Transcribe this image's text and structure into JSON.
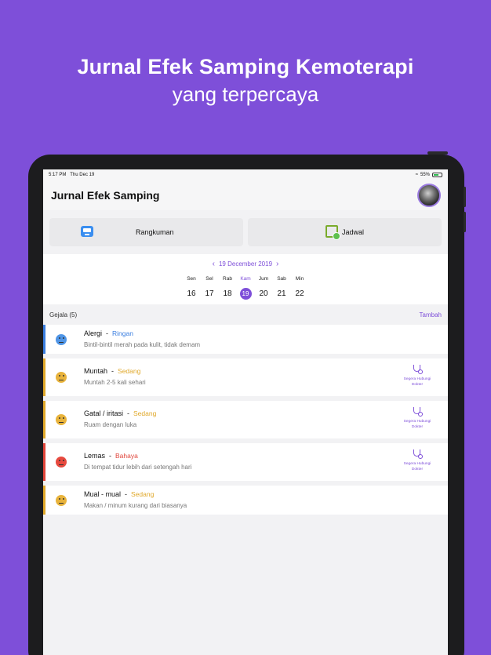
{
  "marketing": {
    "headline": "Jurnal Efek Samping Kemoterapi",
    "subheadline": "yang terpercaya"
  },
  "status_bar": {
    "time": "5:17 PM",
    "date": "Thu Dec 19",
    "battery": "55%"
  },
  "nav": {
    "title": "Jurnal Efek Samping"
  },
  "cards": {
    "summary_label": "Rangkuman",
    "schedule_label": "Jadwal"
  },
  "calendar": {
    "month_label": "19 December 2019",
    "days": [
      {
        "name": "Sen",
        "date": "16"
      },
      {
        "name": "Sel",
        "date": "17"
      },
      {
        "name": "Rab",
        "date": "18"
      },
      {
        "name": "Kam",
        "date": "19"
      },
      {
        "name": "Jum",
        "date": "20"
      },
      {
        "name": "Sab",
        "date": "21"
      },
      {
        "name": "Min",
        "date": "22"
      }
    ],
    "selected_index": 3
  },
  "section": {
    "title": "Gejala (5)",
    "add_label": "Tambah"
  },
  "severity_colors": {
    "Ringan": "#3a7ee0",
    "Sedang": "#e0a82a",
    "Bahaya": "#e0443a"
  },
  "symptoms": [
    {
      "name": "Alergi",
      "sep": "-",
      "severity": "Ringan",
      "desc": "Bintil-bintil merah pada kulit, tidak demam",
      "contact": ""
    },
    {
      "name": "Muntah",
      "sep": "-",
      "severity": "Sedang",
      "desc": "Muntah 2-5 kali sehari",
      "contact": "Segera Hubungi Dokter"
    },
    {
      "name": "Gatal / iritasi",
      "sep": "-",
      "severity": "Sedang",
      "desc": "Ruam dengan luka",
      "contact": "Segera Hubungi Dokter"
    },
    {
      "name": "Lemas",
      "sep": "-",
      "severity": "Bahaya",
      "desc": "Di tempat tidur lebih dari setengah hari",
      "contact": "Segera Hubungi Dokter"
    },
    {
      "name": "Mual - mual",
      "sep": "-",
      "severity": "Sedang",
      "desc": "Makan / minum kurang dari biasanya",
      "contact": ""
    }
  ]
}
